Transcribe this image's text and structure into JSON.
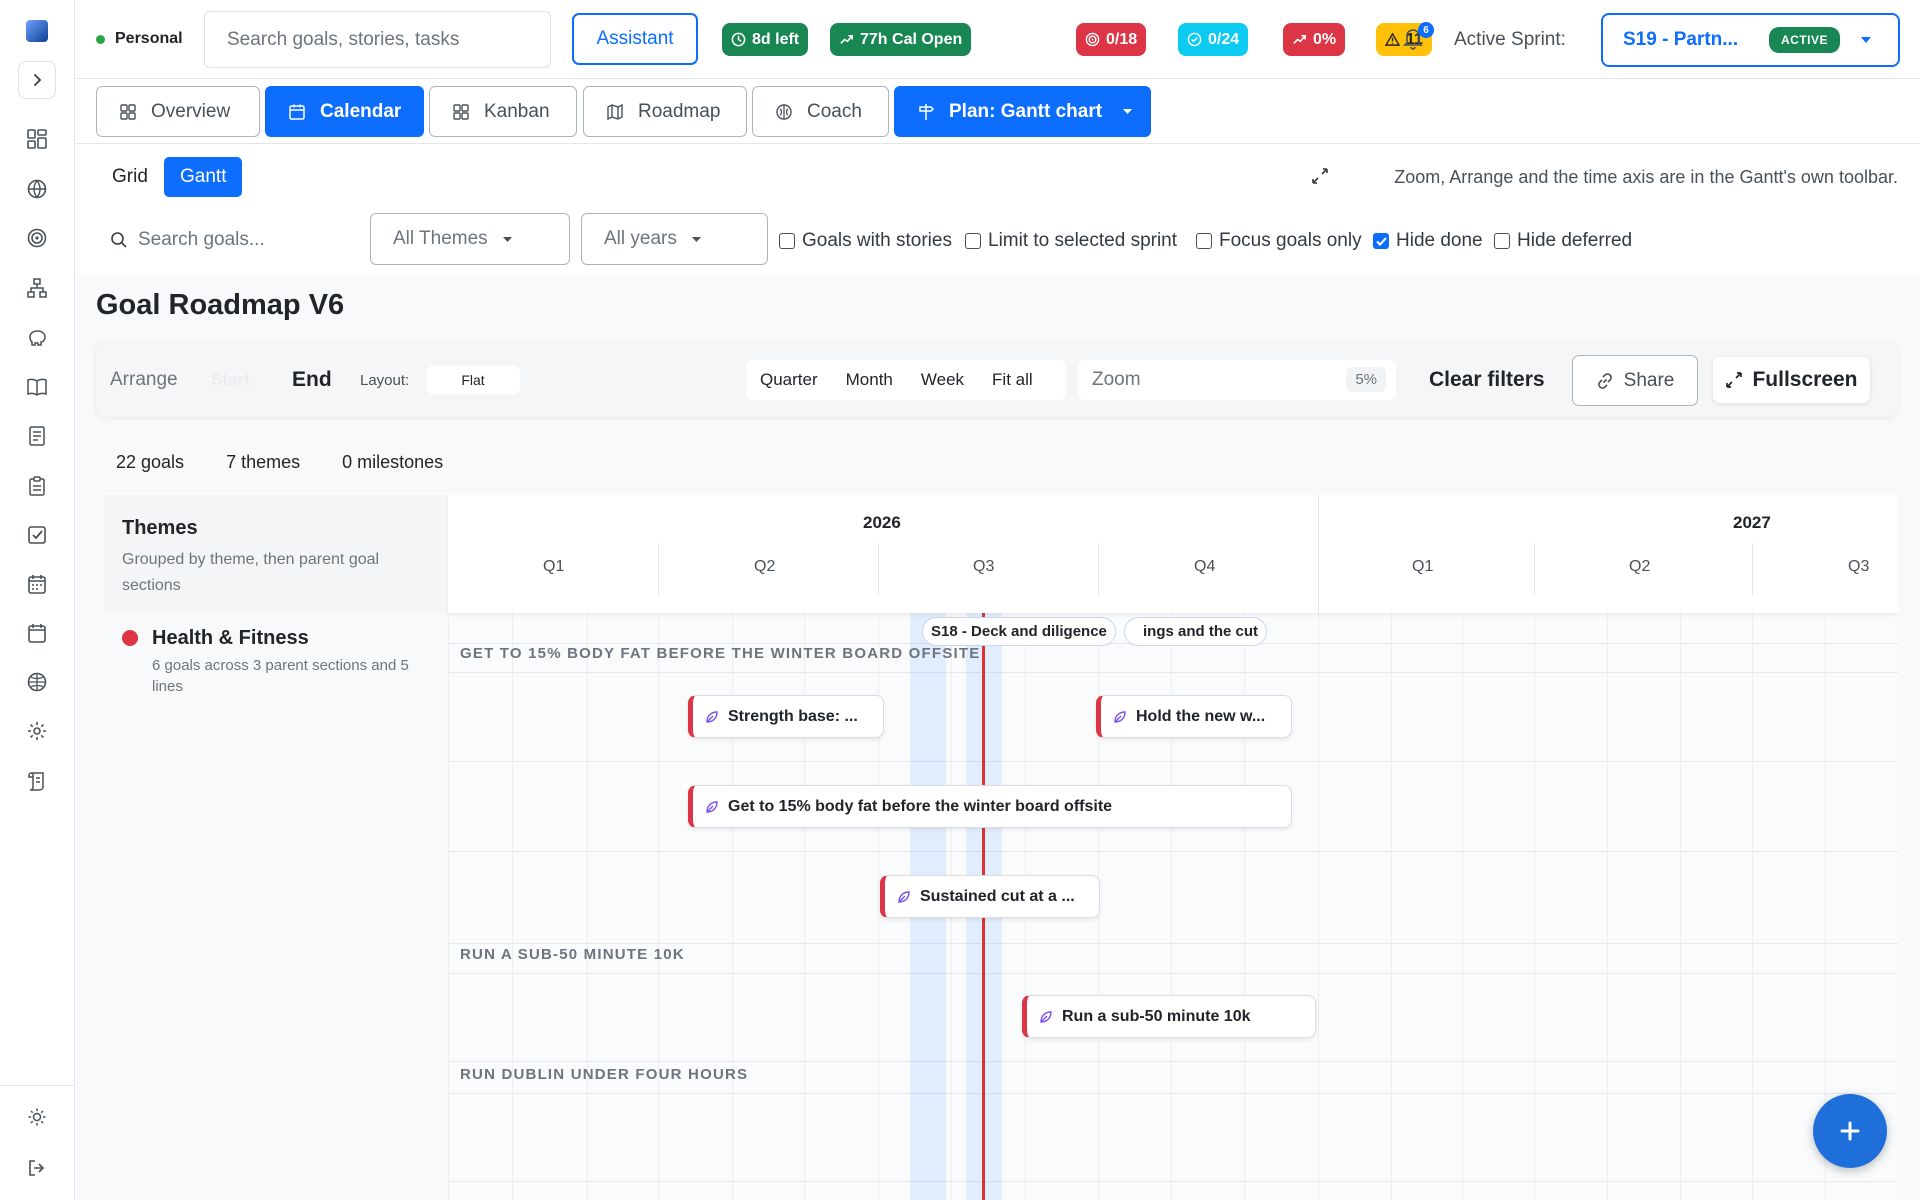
{
  "header": {
    "workspace": "Personal",
    "search_placeholder": "Search goals, stories, tasks",
    "assistant_label": "Assistant",
    "pills": [
      {
        "label": "8d left",
        "color": "#198754"
      },
      {
        "label": "77h Cal Open",
        "color": "#198754"
      },
      {
        "label": "0/18",
        "color": "#dc3545"
      },
      {
        "label": "0/24",
        "color": "#0dcaf0"
      },
      {
        "label": "0%",
        "color": "#dc3545"
      },
      {
        "label": "11",
        "color": "#ffc107"
      }
    ],
    "notifications": "6",
    "active_sprint_label": "Active Sprint:",
    "sprint_name": "S19 - Partn...",
    "sprint_status": "ACTIVE"
  },
  "tabs": {
    "overview": "Overview",
    "calendar": "Calendar",
    "kanban": "Kanban",
    "roadmap": "Roadmap",
    "coach": "Coach",
    "plan": "Plan: Gantt chart"
  },
  "modes": {
    "grid": "Grid",
    "gantt": "Gantt",
    "hint": "Zoom, Arrange and the time axis are in the Gantt's own toolbar."
  },
  "filters": {
    "search_placeholder": "Search goals...",
    "themes": "All Themes",
    "years": "All years",
    "checks": [
      {
        "label": "Goals with stories",
        "checked": false
      },
      {
        "label": "Limit to selected sprint",
        "checked": false
      },
      {
        "label": "Focus goals only",
        "checked": false
      },
      {
        "label": "Hide done",
        "checked": true
      },
      {
        "label": "Hide deferred",
        "checked": false
      }
    ]
  },
  "page_title": "Goal Roadmap V6",
  "toolbar": {
    "arrange": "Arrange",
    "start": "Start",
    "end": "End",
    "layout_label": "Layout:",
    "layout_value": "Flat",
    "zoom_quarter": "Quarter",
    "zoom_month": "Month",
    "zoom_week": "Week",
    "zoom_fit": "Fit all",
    "zoom_label": "Zoom",
    "zoom_pct": "5%",
    "clear_filters": "Clear filters",
    "share": "Share",
    "fullscreen": "Fullscreen"
  },
  "stats": {
    "goals": "22 goals",
    "themes": "7 themes",
    "milestones": "0 milestones"
  },
  "gantt": {
    "left_title": "Themes",
    "left_subtitle": "Grouped by theme, then parent goal sections",
    "theme": {
      "name": "Health & Fitness",
      "subtitle": "6 goals across 3 parent sections and 5 lines",
      "color": "#dc3545"
    },
    "years": [
      "2026",
      "2027"
    ],
    "quarters": [
      "Q1",
      "Q2",
      "Q3",
      "Q4",
      "Q1",
      "Q2",
      "Q3"
    ],
    "sprint_tag": "S18 - Deck and diligence",
    "sprint_tag_overflow": "ings and the cut",
    "sections": [
      "GET TO 15% BODY FAT BEFORE THE WINTER BOARD OFFSITE",
      "RUN A SUB-50 MINUTE 10K",
      "RUN DUBLIN UNDER FOUR HOURS"
    ],
    "bars": [
      {
        "label": "Strength base: ..."
      },
      {
        "label": "Hold the new w..."
      },
      {
        "label": "Get to 15% body fat before the winter board offsite"
      },
      {
        "label": "Sustained cut at a ..."
      },
      {
        "label": "Run a sub-50 minute 10k"
      }
    ]
  }
}
